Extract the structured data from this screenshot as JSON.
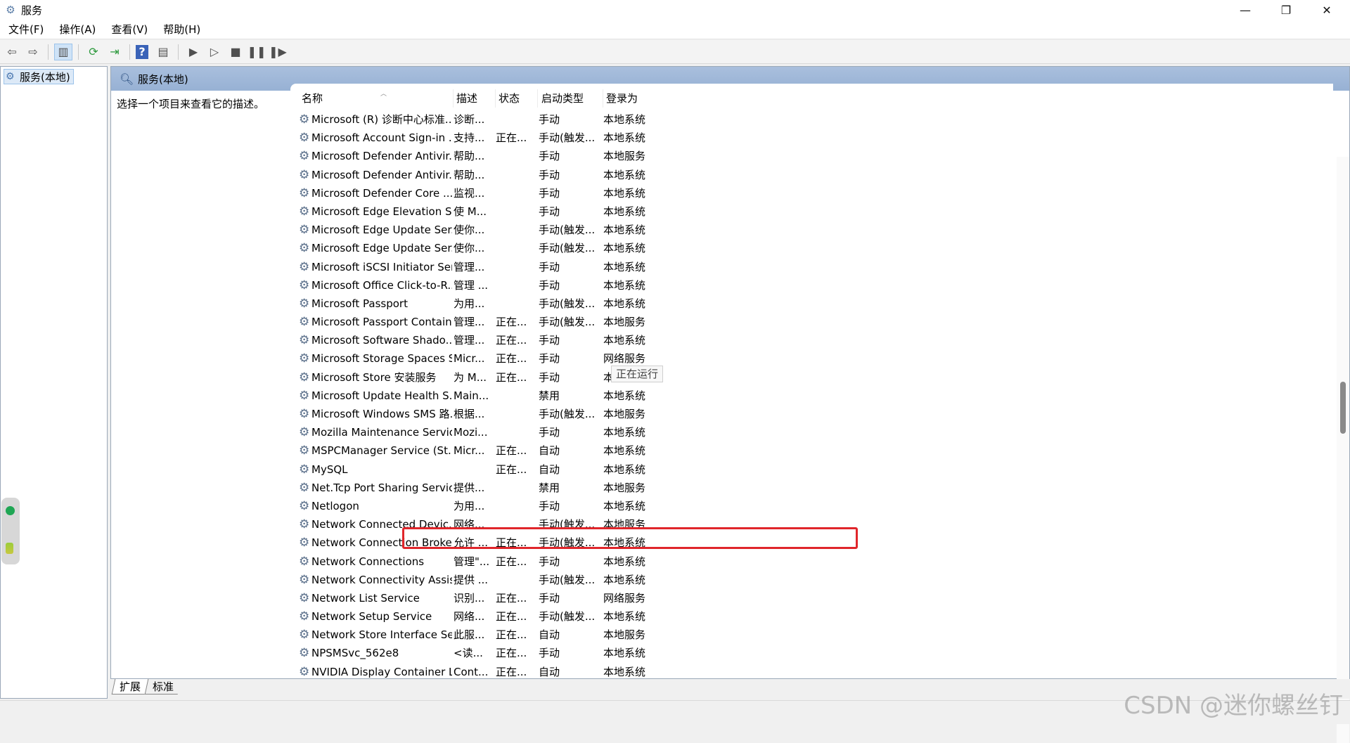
{
  "window": {
    "title": "服务",
    "minimize_label": "—",
    "restore_label": "❐",
    "close_label": "✕"
  },
  "menu": [
    "文件(F)",
    "操作(A)",
    "查看(V)",
    "帮助(H)"
  ],
  "toolbar_icons": [
    "back-icon",
    "forward-icon",
    "show-console-tree-icon",
    "refresh-icon",
    "export-list-icon",
    "help-icon",
    "properties-icon",
    "start-service-icon",
    "start-service-alt-icon",
    "stop-service-icon",
    "pause-service-icon",
    "resume-service-icon"
  ],
  "tree": {
    "node_label": "服务(本地)"
  },
  "pane": {
    "header_title": "服务(本地)",
    "description_prompt": "选择一个项目来查看它的描述。"
  },
  "columns": {
    "name": "名称",
    "description": "描述",
    "status": "状态",
    "startup_type": "启动类型",
    "logon_as": "登录为"
  },
  "rows": [
    [
      "Microsoft (R) 诊断中心标准...",
      "诊断...",
      "",
      "手动",
      "本地系统"
    ],
    [
      "Microsoft Account Sign-in ...",
      "支持...",
      "正在...",
      "手动(触发...",
      "本地系统"
    ],
    [
      "Microsoft Defender Antivir...",
      "帮助...",
      "",
      "手动",
      "本地服务"
    ],
    [
      "Microsoft Defender Antivir...",
      "帮助...",
      "",
      "手动",
      "本地系统"
    ],
    [
      "Microsoft Defender Core ...",
      "监视...",
      "",
      "手动",
      "本地系统"
    ],
    [
      "Microsoft Edge Elevation S...",
      "使 M...",
      "",
      "手动",
      "本地系统"
    ],
    [
      "Microsoft Edge Update Ser...",
      "使你...",
      "",
      "手动(触发...",
      "本地系统"
    ],
    [
      "Microsoft Edge Update Ser...",
      "使你...",
      "",
      "手动(触发...",
      "本地系统"
    ],
    [
      "Microsoft iSCSI Initiator Ser...",
      "管理...",
      "",
      "手动",
      "本地系统"
    ],
    [
      "Microsoft Office Click-to-R...",
      "管理 ...",
      "",
      "手动",
      "本地系统"
    ],
    [
      "Microsoft Passport",
      "为用...",
      "",
      "手动(触发...",
      "本地系统"
    ],
    [
      "Microsoft Passport Container",
      "管理...",
      "正在...",
      "手动(触发...",
      "本地服务"
    ],
    [
      "Microsoft Software Shado...",
      "管理...",
      "正在...",
      "手动",
      "本地系统"
    ],
    [
      "Microsoft Storage Spaces S...",
      "Micr...",
      "正在...",
      "手动",
      "网络服务"
    ],
    [
      "Microsoft Store 安装服务",
      "为 M...",
      "正在...",
      "手动",
      "本地系统"
    ],
    [
      "Microsoft Update Health S...",
      "Main...",
      "",
      "禁用",
      "本地系统"
    ],
    [
      "Microsoft Windows SMS 路...",
      "根据...",
      "",
      "手动(触发...",
      "本地服务"
    ],
    [
      "Mozilla Maintenance Service",
      "Mozi...",
      "",
      "手动",
      "本地系统"
    ],
    [
      "MSPCManager Service (St...",
      "Micr...",
      "正在...",
      "自动",
      "本地系统"
    ],
    [
      "MySQL",
      "",
      "正在...",
      "自动",
      "本地系统"
    ],
    [
      "Net.Tcp Port Sharing Service",
      "提供...",
      "",
      "禁用",
      "本地服务"
    ],
    [
      "Netlogon",
      "为用...",
      "",
      "手动",
      "本地系统"
    ],
    [
      "Network Connected Devic...",
      "网络...",
      "",
      "手动(触发...",
      "本地服务"
    ],
    [
      "Network Connection Broker",
      "允许 ...",
      "正在...",
      "手动(触发...",
      "本地系统"
    ],
    [
      "Network Connections",
      "管理\"...",
      "正在...",
      "手动",
      "本地系统"
    ],
    [
      "Network Connectivity Assis...",
      "提供 ...",
      "",
      "手动(触发...",
      "本地系统"
    ],
    [
      "Network List Service",
      "识别...",
      "正在...",
      "手动",
      "网络服务"
    ],
    [
      "Network Setup Service",
      "网络...",
      "正在...",
      "手动(触发...",
      "本地系统"
    ],
    [
      "Network Store Interface Se...",
      "此服...",
      "正在...",
      "自动",
      "本地服务"
    ],
    [
      "NPSMSvc_562e8",
      "<读...",
      "正在...",
      "手动",
      "本地系统"
    ],
    [
      "NVIDIA Display Container LS",
      "Cont...",
      "正在...",
      "自动",
      "本地系统"
    ]
  ],
  "tooltip": "正在运行",
  "tabs": [
    "扩展",
    "标准"
  ],
  "watermark": "CSDN @迷你螺丝钉",
  "colors": {
    "highlight": "#e0262b",
    "header_bar": "#a9bfdd",
    "running_dot": "#1fa654"
  }
}
